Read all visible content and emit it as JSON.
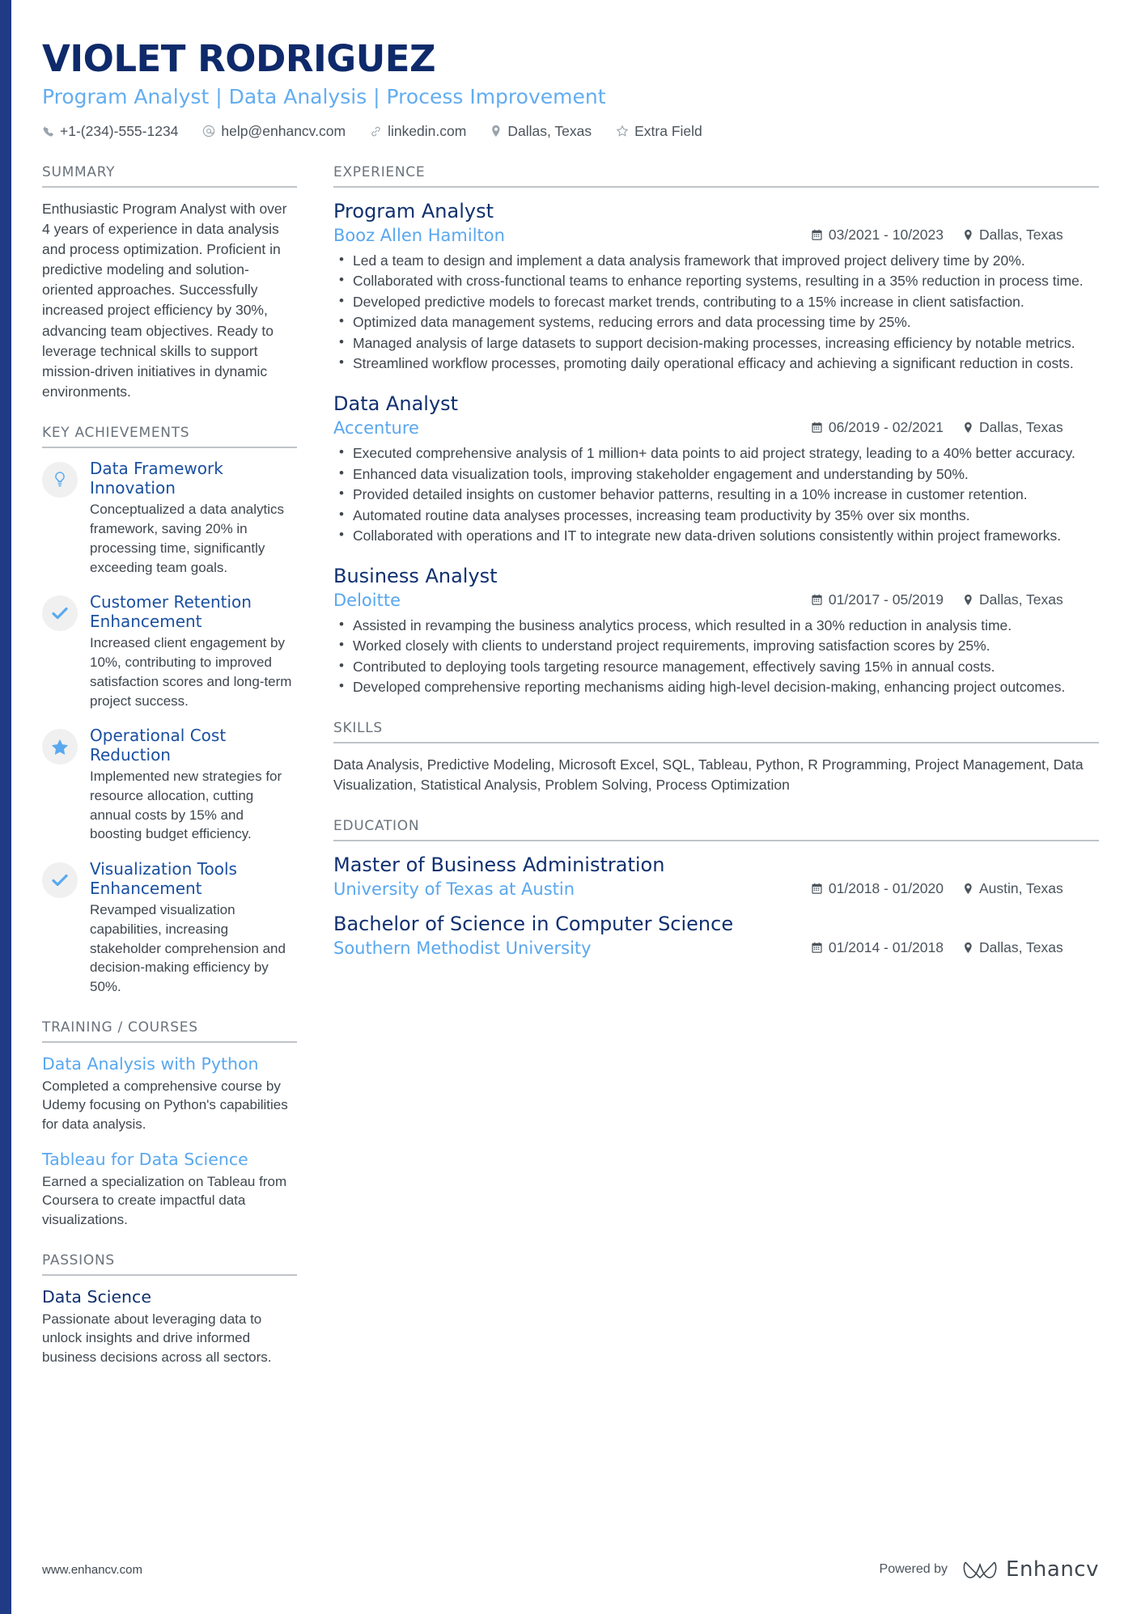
{
  "header": {
    "name": "VIOLET RODRIGUEZ",
    "headline": "Program Analyst | Data Analysis | Process Improvement",
    "contacts": [
      {
        "icon": "phone-icon",
        "text": "+1-(234)-555-1234"
      },
      {
        "icon": "email-icon",
        "text": "help@enhancv.com"
      },
      {
        "icon": "link-icon",
        "text": "linkedin.com"
      },
      {
        "icon": "location-pin-icon",
        "text": "Dallas, Texas"
      },
      {
        "icon": "star-outline-icon",
        "text": "Extra Field"
      }
    ]
  },
  "left": {
    "summary": {
      "title": "SUMMARY",
      "text": "Enthusiastic Program Analyst with over 4 years of experience in data analysis and process optimization. Proficient in predictive modeling and solution-oriented approaches. Successfully increased project efficiency by 30%, advancing team objectives. Ready to leverage technical skills to support mission-driven initiatives in dynamic environments."
    },
    "achievements": {
      "title": "KEY ACHIEVEMENTS",
      "items": [
        {
          "icon": "lightbulb-icon",
          "title": "Data Framework Innovation",
          "desc": "Conceptualized a data analytics framework, saving 20% in processing time, significantly exceeding team goals."
        },
        {
          "icon": "check-icon",
          "title": "Customer Retention Enhancement",
          "desc": "Increased client engagement by 10%, contributing to improved satisfaction scores and long-term project success."
        },
        {
          "icon": "star-icon",
          "title": "Operational Cost Reduction",
          "desc": "Implemented new strategies for resource allocation, cutting annual costs by 15% and boosting budget efficiency."
        },
        {
          "icon": "check-icon",
          "title": "Visualization Tools Enhancement",
          "desc": "Revamped visualization capabilities, increasing stakeholder comprehension and decision-making efficiency by 50%."
        }
      ]
    },
    "training": {
      "title": "TRAINING / COURSES",
      "items": [
        {
          "title": "Data Analysis with Python",
          "desc": "Completed a comprehensive course by Udemy focusing on Python's capabilities for data analysis."
        },
        {
          "title": "Tableau for Data Science",
          "desc": "Earned a specialization on Tableau from Coursera to create impactful data visualizations."
        }
      ]
    },
    "passions": {
      "title": "PASSIONS",
      "items": [
        {
          "title": "Data Science",
          "desc": "Passionate about leveraging data to unlock insights and drive informed business decisions across all sectors."
        }
      ]
    }
  },
  "right": {
    "experience": {
      "title": "EXPERIENCE",
      "jobs": [
        {
          "role": "Program Analyst",
          "company": "Booz Allen Hamilton",
          "dates": "03/2021 - 10/2023",
          "location": "Dallas, Texas",
          "bullets": [
            "Led a team to design and implement a data analysis framework that improved project delivery time by 20%.",
            "Collaborated with cross-functional teams to enhance reporting systems, resulting in a 35% reduction in process time.",
            "Developed predictive models to forecast market trends, contributing to a 15% increase in client satisfaction.",
            "Optimized data management systems, reducing errors and data processing time by 25%.",
            "Managed analysis of large datasets to support decision-making processes, increasing efficiency by notable metrics.",
            "Streamlined workflow processes, promoting daily operational efficacy and achieving a significant reduction in costs."
          ]
        },
        {
          "role": "Data Analyst",
          "company": "Accenture",
          "dates": "06/2019 - 02/2021",
          "location": "Dallas, Texas",
          "bullets": [
            "Executed comprehensive analysis of 1 million+ data points to aid project strategy, leading to a 40% better accuracy.",
            "Enhanced data visualization tools, improving stakeholder engagement and understanding by 50%.",
            "Provided detailed insights on customer behavior patterns, resulting in a 10% increase in customer retention.",
            "Automated routine data analyses processes, increasing team productivity by 35% over six months.",
            "Collaborated with operations and IT to integrate new data-driven solutions consistently within project frameworks."
          ]
        },
        {
          "role": "Business Analyst",
          "company": "Deloitte",
          "dates": "01/2017 - 05/2019",
          "location": "Dallas, Texas",
          "bullets": [
            "Assisted in revamping the business analytics process, which resulted in a 30% reduction in analysis time.",
            "Worked closely with clients to understand project requirements, improving satisfaction scores by 25%.",
            "Contributed to deploying tools targeting resource management, effectively saving 15% in annual costs.",
            "Developed comprehensive reporting mechanisms aiding high-level decision-making, enhancing project outcomes."
          ]
        }
      ]
    },
    "skills": {
      "title": "SKILLS",
      "text": "Data Analysis, Predictive Modeling, Microsoft Excel, SQL, Tableau, Python, R Programming, Project Management, Data Visualization, Statistical Analysis, Problem Solving, Process Optimization"
    },
    "education": {
      "title": "EDUCATION",
      "items": [
        {
          "degree": "Master of Business Administration",
          "school": "University of Texas at Austin",
          "dates": "01/2018 - 01/2020",
          "location": "Austin, Texas"
        },
        {
          "degree": "Bachelor of Science in Computer Science",
          "school": "Southern Methodist University",
          "dates": "01/2014 - 01/2018",
          "location": "Dallas, Texas"
        }
      ]
    }
  },
  "footer": {
    "url": "www.enhancv.com",
    "powered_by": "Powered by",
    "brand": "Enhancv"
  },
  "colors": {
    "accent_bar": "#1f3b86",
    "name": "#0e2a6b",
    "headline": "#63adf0",
    "link_blue": "#59a7ef",
    "heading_dark": "#10306f",
    "body_text": "#3f474f",
    "section_label": "#6b737b",
    "icon_blue": "#5aa9ef"
  }
}
